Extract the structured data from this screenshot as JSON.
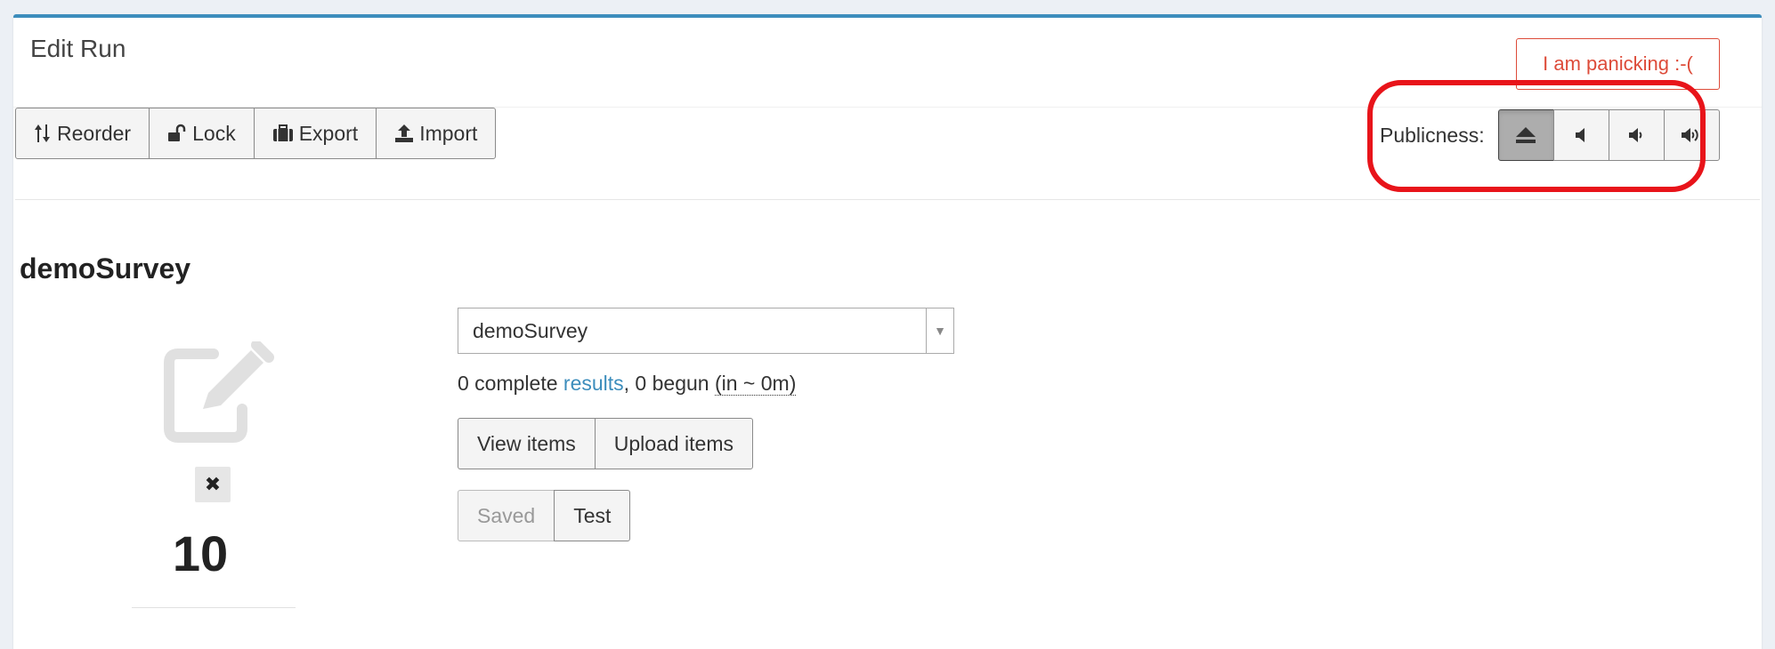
{
  "header": {
    "title": "Edit Run",
    "panic_label": "I am panicking :-("
  },
  "toolbar": {
    "reorder_label": "Reorder",
    "lock_label": "Lock",
    "export_label": "Export",
    "import_label": "Import"
  },
  "publicness": {
    "label": "Publicness:",
    "options": [
      "eject-icon",
      "volume-off-icon",
      "volume-down-icon",
      "volume-up-icon"
    ],
    "selected_index": 0
  },
  "survey": {
    "title": "demoSurvey",
    "select_value": "demoSurvey",
    "complete_count": "0 complete",
    "results_link": "results",
    "begun_text": ", 0 begun",
    "time_estimate": "(in ~ 0m)",
    "view_items_label": "View items",
    "upload_items_label": "Upload items",
    "saved_label": "Saved",
    "test_label": "Test",
    "remove_label": "✖",
    "position": "10"
  },
  "colors": {
    "accent": "#3c8dbc",
    "danger": "#dd4b39",
    "highlight": "#e8141a"
  }
}
